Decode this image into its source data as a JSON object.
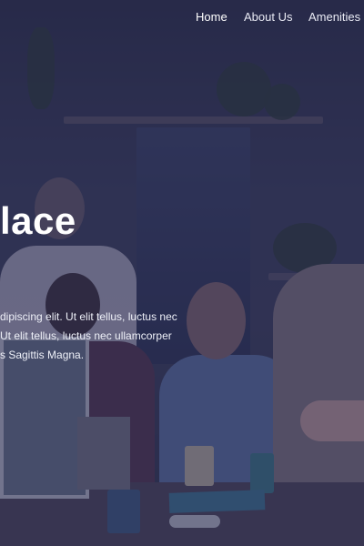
{
  "nav": {
    "items": [
      {
        "label": "Home",
        "active": true
      },
      {
        "label": "About Us",
        "active": false
      },
      {
        "label": "Amenities",
        "active": false
      }
    ]
  },
  "hero": {
    "title": "lace",
    "lines": [
      "dipiscing elit. Ut elit tellus, luctus nec",
      "Ut elit tellus, luctus nec ullamcorper",
      "s Sagittis Magna."
    ]
  },
  "colors": {
    "overlay": "#26284e",
    "text": "#ffffff"
  }
}
